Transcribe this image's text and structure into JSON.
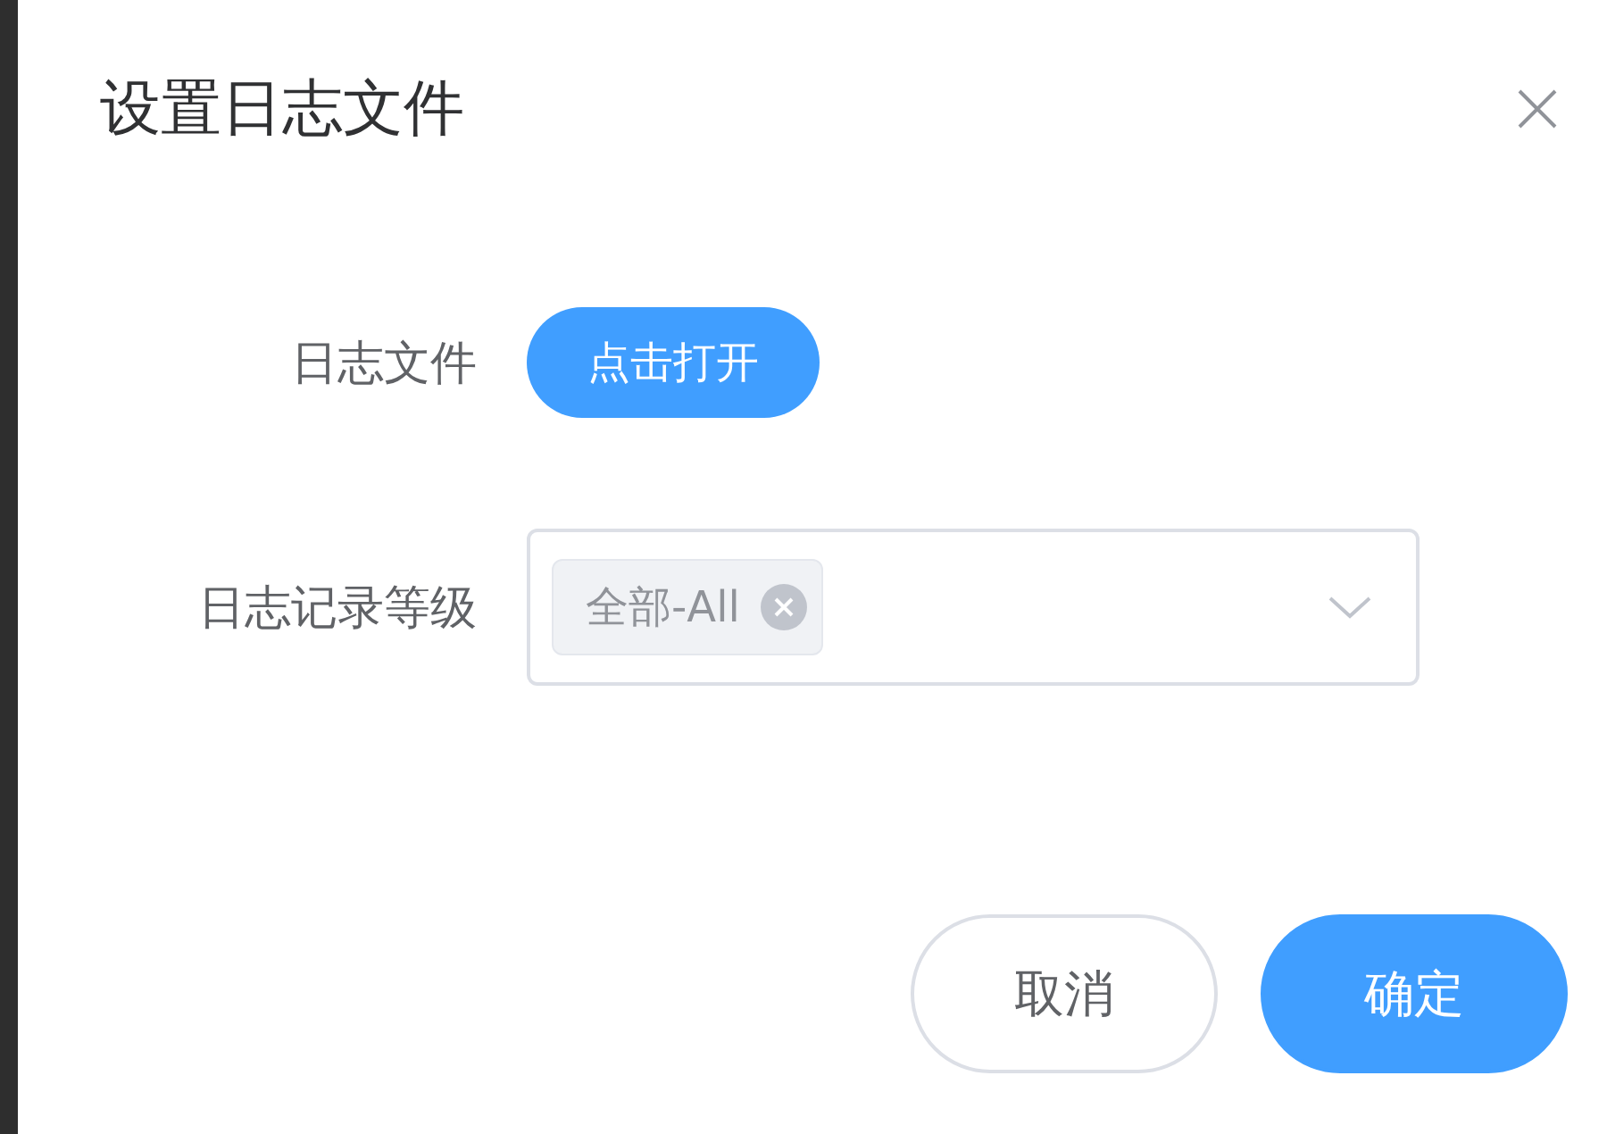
{
  "dialog": {
    "title": "设置日志文件"
  },
  "form": [
    {
      "kind": "button",
      "label": "日志文件",
      "button": "点击打开"
    },
    {
      "kind": "select",
      "label": "日志记录等级",
      "tags": [
        {
          "text": "全部-All"
        }
      ]
    }
  ],
  "buttons": [
    {
      "kind": "secondary",
      "label": "取消"
    },
    {
      "kind": "primary",
      "label": "确定"
    }
  ]
}
